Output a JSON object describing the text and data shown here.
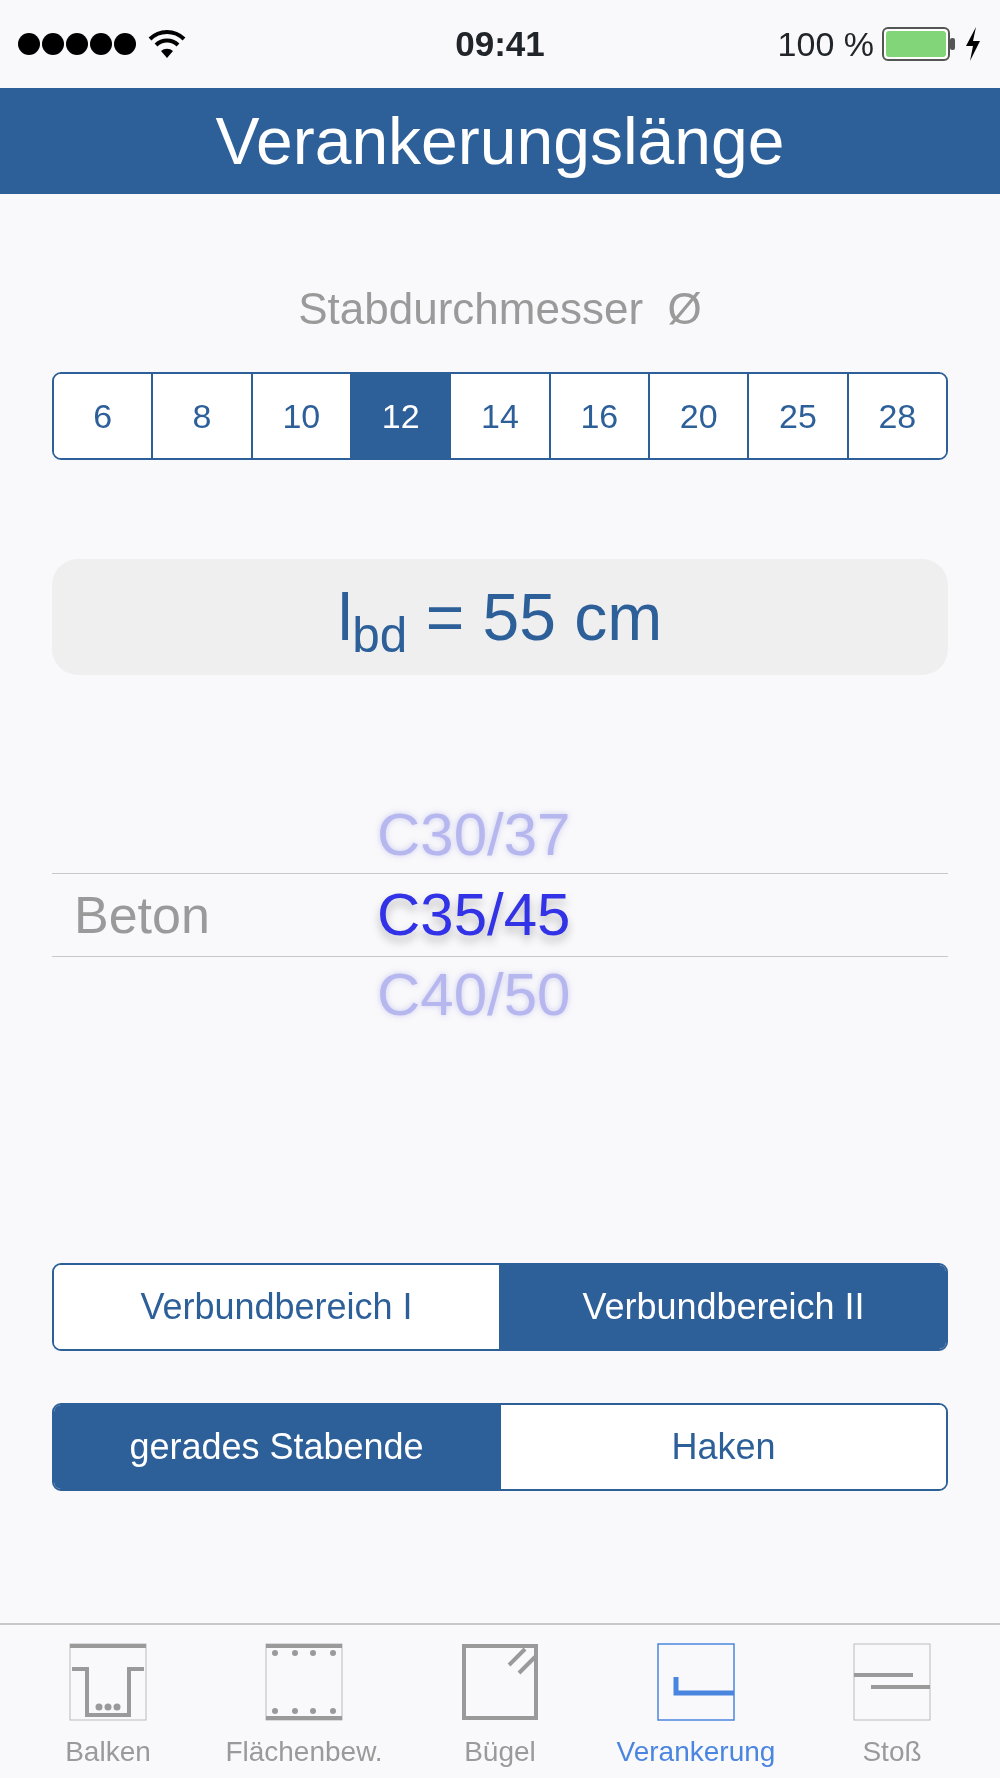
{
  "status_bar": {
    "time": "09:41",
    "battery": "100 %"
  },
  "header": {
    "title": "Verankerungslänge"
  },
  "diameter": {
    "label": "Stabdurchmesser  Ø",
    "options": [
      {
        "label": "6",
        "selected": false
      },
      {
        "label": "8",
        "selected": false
      },
      {
        "label": "10",
        "selected": false
      },
      {
        "label": "12",
        "selected": true
      },
      {
        "label": "14",
        "selected": false
      },
      {
        "label": "16",
        "selected": false
      },
      {
        "label": "20",
        "selected": false
      },
      {
        "label": "25",
        "selected": false
      },
      {
        "label": "28",
        "selected": false
      }
    ]
  },
  "result": {
    "text": "l$_{bd}$ = 55 cm"
  },
  "picker": {
    "label": "Beton",
    "options": [
      {
        "label": "C30/37",
        "selected": false
      },
      {
        "label": "C35/45",
        "selected": true
      },
      {
        "label": "C40/50",
        "selected": false
      }
    ]
  },
  "bond_zone": [
    {
      "label": "Verbundbereich I",
      "selected": false
    },
    {
      "label": "Verbundbereich II",
      "selected": true
    }
  ],
  "bar_end": [
    {
      "label": "gerades Stabende",
      "selected": true
    },
    {
      "label": "Haken",
      "selected": false
    }
  ],
  "tab_bar": [
    {
      "label": "Balken",
      "kind": "beam",
      "selected": false
    },
    {
      "label": "Flächenbew.",
      "kind": "slab",
      "selected": false
    },
    {
      "label": "Bügel",
      "kind": "stirrup",
      "selected": false
    },
    {
      "label": "Verankerung",
      "kind": "anchor",
      "selected": true
    },
    {
      "label": "Stoß",
      "kind": "lap",
      "selected": false
    }
  ]
}
